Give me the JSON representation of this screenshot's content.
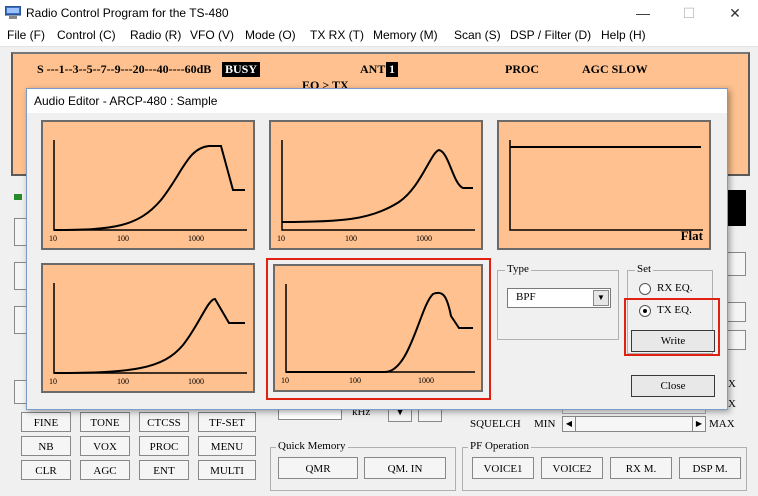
{
  "window": {
    "title": "Radio Control Program for the TS-480",
    "minimize": "—",
    "maximize": "☐",
    "close": "✕"
  },
  "menu": [
    "File (F)",
    "Control (C)",
    "Radio (R)",
    "VFO (V)",
    "Mode (O)",
    "TX RX (T)",
    "Memory (M)",
    "Scan (S)",
    "DSP / Filter (D)",
    "Help (H)"
  ],
  "status": {
    "s_meter": "S    ---1--3--5--7--9---20---40----60dB",
    "busy": "BUSY",
    "ant": "ANT",
    "ant_num": "1",
    "proc": "PROC",
    "agc": "AGC SLOW",
    "eq_tx": "EQ > TX"
  },
  "dialog": {
    "title": "Audio Editor - ARCP-480 : Sample",
    "graph_ticks": [
      "10",
      "100",
      "1000"
    ],
    "flat_label": "Flat",
    "type_group": "Type",
    "type_value": "BPF",
    "set_group": "Set",
    "rx_eq": "RX EQ.",
    "tx_eq": "TX EQ.",
    "write": "Write",
    "close": "Close"
  },
  "buttons": {
    "row1": [
      "FINE",
      "TONE",
      "CTCSS",
      "TF-SET"
    ],
    "row2": [
      "NB",
      "VOX",
      "PROC",
      "MENU"
    ],
    "row3": [
      "CLR",
      "AGC",
      "ENT",
      "MULTI"
    ]
  },
  "quick_memory": {
    "label": "Quick Memory",
    "qmr": "QMR",
    "qmin": "QM. IN"
  },
  "khz": "kHz",
  "squelch": {
    "label": "SQUELCH",
    "min": "MIN",
    "max": "MAX",
    "x": "X"
  },
  "pf": {
    "label": "PF Operation",
    "buttons": [
      "VOICE1",
      "VOICE2",
      "RX M.",
      "DSP M."
    ]
  },
  "colors": {
    "panel": "#fec18f",
    "highlight": "#e02010"
  }
}
